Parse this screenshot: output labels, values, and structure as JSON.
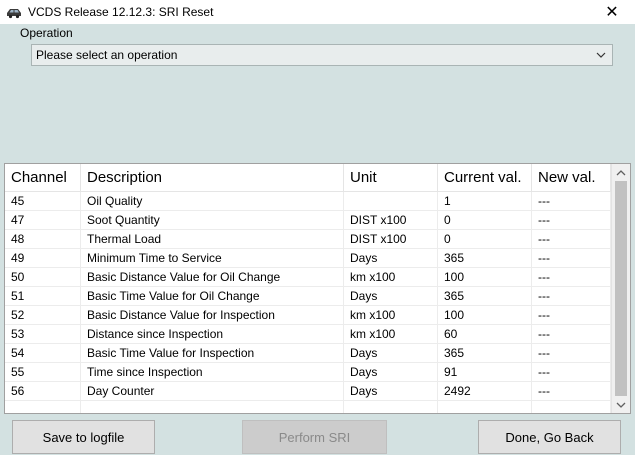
{
  "window": {
    "title": "VCDS Release 12.12.3:  SRI Reset",
    "app_icon": "vcds-car-icon",
    "close_glyph": "✕"
  },
  "operation": {
    "label": "Operation",
    "selected": "Please select an operation"
  },
  "table": {
    "headers": [
      "Channel",
      "Description",
      "Unit",
      "Current val.",
      "New val."
    ],
    "rows": [
      {
        "channel": "45",
        "description": "Oil Quality",
        "unit": "",
        "current": "1",
        "new": "---"
      },
      {
        "channel": "47",
        "description": "Soot Quantity",
        "unit": "DIST x100",
        "current": "0",
        "new": "---"
      },
      {
        "channel": "48",
        "description": "Thermal Load",
        "unit": "DIST x100",
        "current": "0",
        "new": "---"
      },
      {
        "channel": "49",
        "description": "Minimum Time to Service",
        "unit": "Days",
        "current": "365",
        "new": "---"
      },
      {
        "channel": "50",
        "description": "Basic Distance Value for Oil Change",
        "unit": "km x100",
        "current": "100",
        "new": "---"
      },
      {
        "channel": "51",
        "description": "Basic Time Value for Oil Change",
        "unit": "Days",
        "current": "365",
        "new": "---"
      },
      {
        "channel": "52",
        "description": "Basic Distance Value for Inspection",
        "unit": "km x100",
        "current": "100",
        "new": "---"
      },
      {
        "channel": "53",
        "description": "Distance since Inspection",
        "unit": "km x100",
        "current": "60",
        "new": "---"
      },
      {
        "channel": "54",
        "description": "Basic Time Value for Inspection",
        "unit": "Days",
        "current": "365",
        "new": "---"
      },
      {
        "channel": "55",
        "description": "Time since Inspection",
        "unit": "Days",
        "current": "91",
        "new": "---"
      },
      {
        "channel": "56",
        "description": "Day Counter",
        "unit": "Days",
        "current": "2492",
        "new": "---"
      },
      {
        "channel": "",
        "description": "",
        "unit": "",
        "current": "",
        "new": ""
      }
    ]
  },
  "buttons": {
    "save": "Save to logfile",
    "perform_sri": "Perform SRI",
    "done": "Done, Go Back"
  },
  "colors": {
    "background": "#d3e1e1",
    "disabled_text": "#8a8a8a"
  }
}
